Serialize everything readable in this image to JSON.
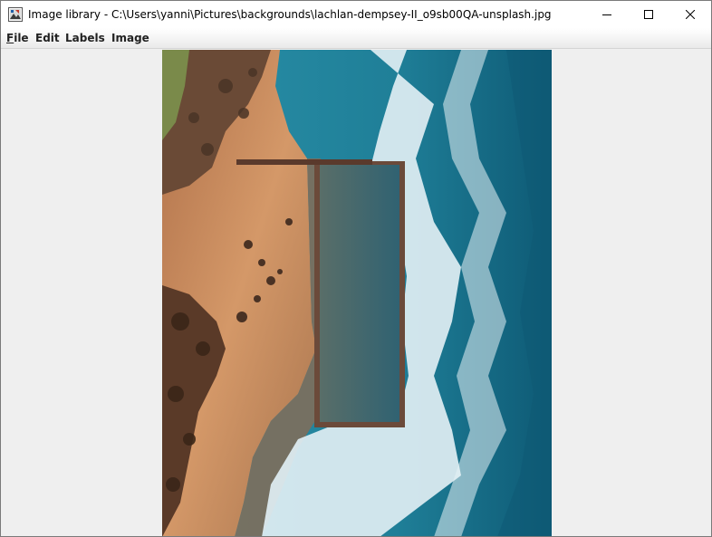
{
  "window": {
    "title": "Image library - C:\\Users\\yanni\\Pictures\\backgrounds\\lachlan-dempsey-II_o9sb00QA-unsplash.jpg",
    "icon": "app-icon",
    "controls": [
      "minimize-icon",
      "maximize-icon",
      "close-icon"
    ]
  },
  "menubar": {
    "items": [
      {
        "label": "File",
        "mnemonic": "F",
        "rest": "ile"
      },
      {
        "label": "Edit",
        "mnemonic": "",
        "rest": "Edit"
      },
      {
        "label": "Labels",
        "mnemonic": "",
        "rest": "Labels"
      },
      {
        "label": "Image",
        "mnemonic": "",
        "rest": "Image"
      }
    ]
  },
  "image_view": {
    "description_icon": "aerial-photo-ocean-pool",
    "colors": {
      "sand": "#c98a5c",
      "rock": "#5a3a28",
      "ocean": "#1f7f98",
      "deep_ocean": "#0e5a75",
      "foam": "#e8f2f6",
      "pool_water": "#3f6a72",
      "pool_wall": "#6b4a3a"
    }
  }
}
